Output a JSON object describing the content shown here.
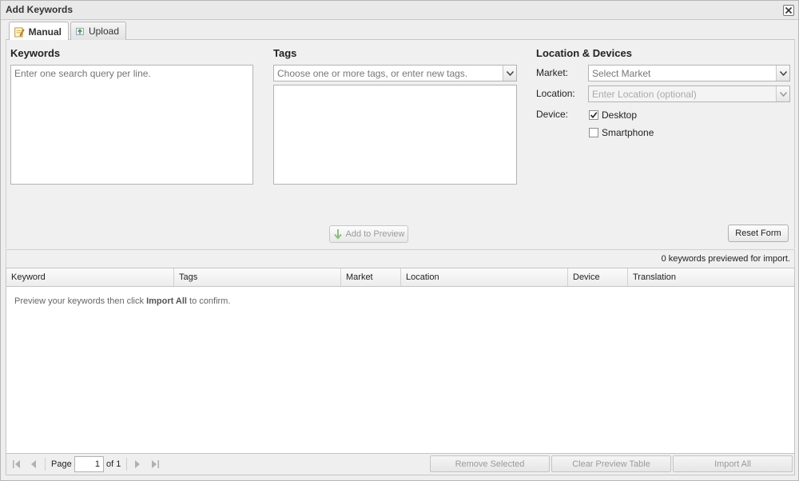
{
  "window": {
    "title": "Add Keywords"
  },
  "tabs": [
    {
      "label": "Manual",
      "active": true,
      "icon": "pencil-note-icon"
    },
    {
      "label": "Upload",
      "active": false,
      "icon": "upload-icon"
    }
  ],
  "keywords": {
    "heading": "Keywords",
    "placeholder": "Enter one search query per line."
  },
  "tags": {
    "heading": "Tags",
    "combo_placeholder": "Choose one or more tags, or enter new tags."
  },
  "location_devices": {
    "heading": "Location & Devices",
    "market_label": "Market:",
    "market_placeholder": "Select Market",
    "location_label": "Location:",
    "location_placeholder": "Enter Location (optional)",
    "device_label": "Device:",
    "devices": [
      {
        "label": "Desktop",
        "checked": true
      },
      {
        "label": "Smartphone",
        "checked": false
      }
    ]
  },
  "buttons": {
    "add_to_preview": "Add to Preview",
    "reset_form": "Reset Form"
  },
  "preview": {
    "count_text": "0 keywords previewed for import.",
    "columns": [
      "Keyword",
      "Tags",
      "Market",
      "Location",
      "Device",
      "Translation"
    ],
    "empty_prefix": "Preview your keywords then click ",
    "empty_bold": "Import All",
    "empty_suffix": " to confirm."
  },
  "pager": {
    "page_label": "Page",
    "page_value": "1",
    "of_text": "of 1"
  },
  "footer_buttons": {
    "remove_selected": "Remove Selected",
    "clear_preview": "Clear Preview Table",
    "import_all": "Import All"
  },
  "colors": {
    "window_bg": "#eeeeee",
    "accent_green": "#6aa84f",
    "disabled_text": "#9a9a9a"
  }
}
